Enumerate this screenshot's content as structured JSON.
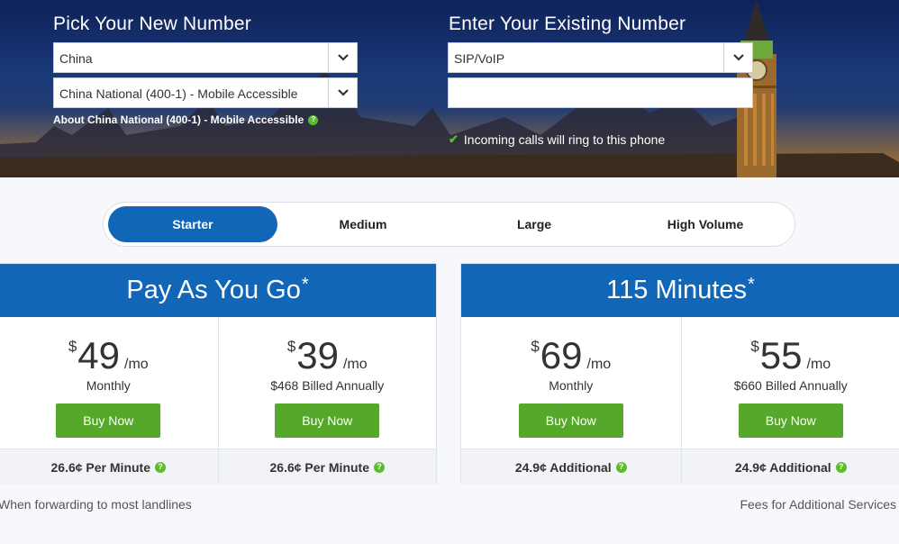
{
  "hero": {
    "pick_title": "Pick Your New Number",
    "country_value": "China",
    "plan_type_value": "China National (400-1) - Mobile Accessible",
    "about_link": "About China National (400-1) - Mobile Accessible",
    "enter_title": "Enter Your Existing Number",
    "forward_value": "SIP/VoIP",
    "number_value": "",
    "ring_note": "Incoming calls will ring to this phone"
  },
  "tabs": [
    {
      "label": "Starter",
      "active": true
    },
    {
      "label": "Medium",
      "active": false
    },
    {
      "label": "Large",
      "active": false
    },
    {
      "label": "High Volume",
      "active": false
    }
  ],
  "plans": [
    {
      "title": "Pay As You Go",
      "asterisk": "*",
      "options": [
        {
          "currency": "$",
          "amount": "49",
          "per": "/mo",
          "billing": "Monthly",
          "button": "Buy Now",
          "rate": "26.6¢ Per Minute"
        },
        {
          "currency": "$",
          "amount": "39",
          "per": "/mo",
          "billing": "$468 Billed Annually",
          "button": "Buy Now",
          "rate": "26.6¢ Per Minute"
        }
      ]
    },
    {
      "title": "115 Minutes",
      "asterisk": "*",
      "options": [
        {
          "currency": "$",
          "amount": "69",
          "per": "/mo",
          "billing": "Monthly",
          "button": "Buy Now",
          "rate": "24.9¢ Additional"
        },
        {
          "currency": "$",
          "amount": "55",
          "per": "/mo",
          "billing": "$660 Billed Annually",
          "button": "Buy Now",
          "rate": "24.9¢ Additional"
        }
      ]
    }
  ],
  "notes": {
    "left": "When forwarding to most landlines",
    "right": "Fees for Additional Services"
  },
  "colors": {
    "accent": "#1266b8",
    "buy_button": "#56a82a",
    "help_icon": "#5bbd2c"
  }
}
